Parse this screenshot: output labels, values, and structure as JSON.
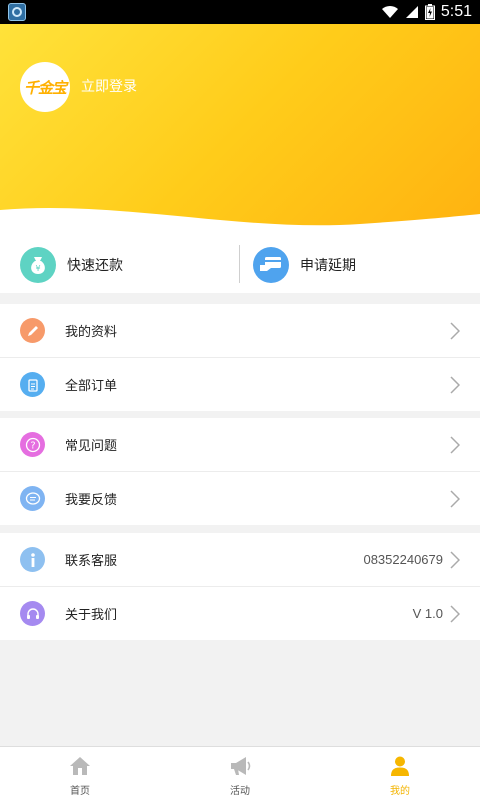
{
  "status_bar": {
    "time": "5:51"
  },
  "header": {
    "logo_text": "千金宝",
    "login_label": "立即登录"
  },
  "quick_actions": [
    {
      "label": "快速还款",
      "icon": "money-bag-icon",
      "color": "#5ed3c3"
    },
    {
      "label": "申请延期",
      "icon": "card-extend-icon",
      "color": "#4fa3ee"
    }
  ],
  "groups": [
    [
      {
        "label": "我的资料",
        "icon": "pencil-icon",
        "color": "#f79a6a",
        "value": ""
      },
      {
        "label": "全部订单",
        "icon": "clipboard-icon",
        "color": "#56aef0",
        "value": ""
      }
    ],
    [
      {
        "label": "常见问题",
        "icon": "question-icon",
        "color": "#e56ee0",
        "value": ""
      },
      {
        "label": "我要反馈",
        "icon": "chat-icon",
        "color": "#7fb4f2",
        "value": ""
      }
    ],
    [
      {
        "label": "联系客服",
        "icon": "info-icon",
        "color": "#8ec0f0",
        "value": "08352240679"
      },
      {
        "label": "关于我们",
        "icon": "headset-icon",
        "color": "#a58af0",
        "value": "V 1.0"
      }
    ]
  ],
  "tabs": [
    {
      "label": "首页",
      "icon": "home-icon",
      "active": false
    },
    {
      "label": "活动",
      "icon": "megaphone-icon",
      "active": false
    },
    {
      "label": "我的",
      "icon": "user-icon",
      "active": true
    }
  ],
  "colors": {
    "accent": "#ffc21a",
    "active_tab": "#f3b400"
  }
}
